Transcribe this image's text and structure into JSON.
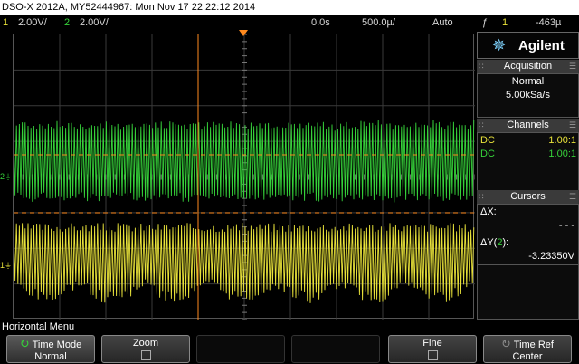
{
  "title": "DSO-X 2012A, MY52444967: Mon Nov 17 22:22:12 2014",
  "status": {
    "ch1_num": "1",
    "ch1_scale": "2.00V/",
    "ch2_num": "2",
    "ch2_scale": "2.00V/",
    "time_delay": "0.0s",
    "time_scale": "500.0µ/",
    "trigger_mode": "Auto",
    "trigger_symbol": "ƒ",
    "trigger_source": "1",
    "trigger_level": "-463µ"
  },
  "panel": {
    "brand": "Agilent",
    "acquisition": {
      "header": "Acquisition",
      "mode": "Normal",
      "rate": "5.00kSa/s"
    },
    "channels": {
      "header": "Channels",
      "rows": [
        {
          "coupling": "DC",
          "probe": "1.00:1",
          "color": "#e8e23a"
        },
        {
          "coupling": "DC",
          "probe": "1.00:1",
          "color": "#36d23a"
        }
      ]
    },
    "cursors": {
      "header": "Cursors",
      "dx_label": "ΔX:",
      "dx_value": "- - -",
      "dy_label_prefix": "ΔY(",
      "dy_label_num": "2",
      "dy_label_suffix": "):",
      "dy_value": "-3.23350V"
    }
  },
  "menu": {
    "label": "Horizontal Menu",
    "keys": [
      {
        "title": "Time Mode",
        "value": "Normal"
      },
      {
        "title": "Zoom",
        "value": ""
      },
      {
        "title": "Fine",
        "value": ""
      },
      {
        "title": "Time Ref",
        "value": "Center"
      }
    ]
  },
  "colors": {
    "ch1": "#e8e23a",
    "ch2": "#36d23a",
    "cursor": "#ff8a1e",
    "trigger_marker": "#ff8a1e"
  },
  "icons": {
    "trigger": "trigger-edge-icon",
    "logo": "agilent-spark-icon",
    "refresh": "cycle-icon"
  }
}
